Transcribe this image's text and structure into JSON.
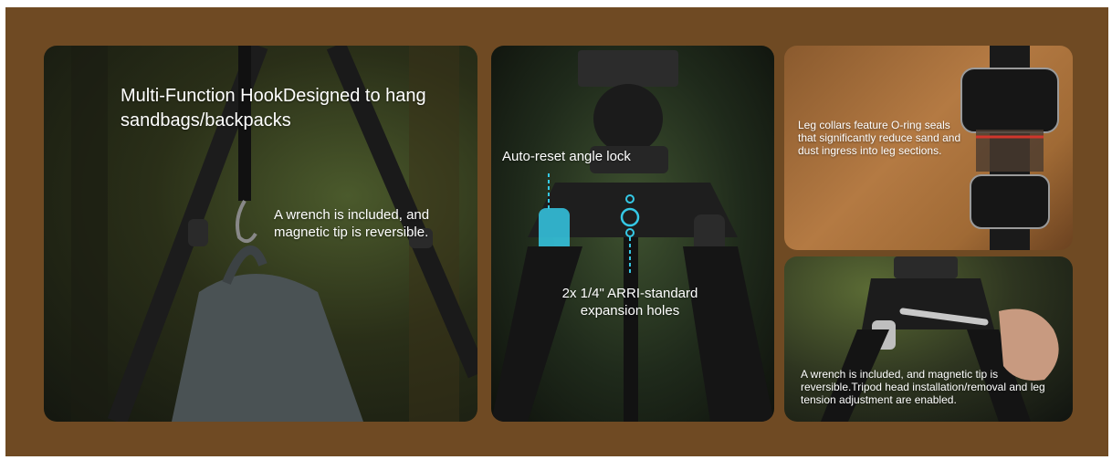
{
  "panel_hook": {
    "title": "Multi-Function HookDesigned to hang sandbags/backpacks",
    "wrench_note": "A wrench is included, and magnetic tip is reversible."
  },
  "panel_head": {
    "angle_lock_label": "Auto-reset angle lock",
    "holes_label": "2x 1/4\" ARRI-standard expansion holes",
    "accent_color": "#35c9e6"
  },
  "panel_collar": {
    "caption": "Leg collars feature O-ring seals that significantly reduce sand and dust ingress into leg sections."
  },
  "panel_wrench": {
    "caption": "A wrench is included, and magnetic tip is reversible.Tripod head installation/removal and leg tension adjustment are enabled."
  },
  "colors": {
    "frame_background": "#6f4a23"
  }
}
